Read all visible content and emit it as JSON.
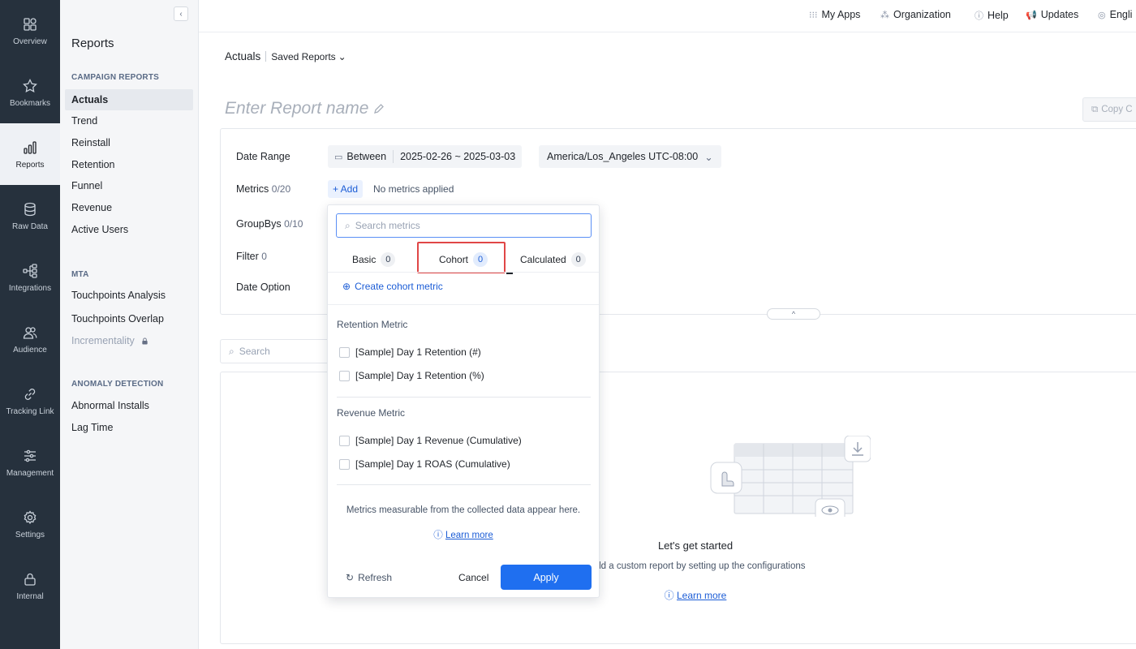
{
  "rail": {
    "items": [
      {
        "label": "Overview",
        "icon": "overview-icon"
      },
      {
        "label": "Bookmarks",
        "icon": "star-icon"
      },
      {
        "label": "Reports",
        "icon": "bar-chart-icon"
      },
      {
        "label": "Raw Data",
        "icon": "database-icon"
      },
      {
        "label": "Integrations",
        "icon": "integrations-icon"
      },
      {
        "label": "Audience",
        "icon": "audience-icon"
      },
      {
        "label": "Tracking Link",
        "icon": "link-icon"
      },
      {
        "label": "Management",
        "icon": "sliders-icon"
      },
      {
        "label": "Settings",
        "icon": "gear-icon"
      },
      {
        "label": "Internal",
        "icon": "lock-icon"
      }
    ],
    "active": "Reports"
  },
  "sidebar": {
    "title": "Reports",
    "sections": [
      {
        "title": "CAMPAIGN REPORTS",
        "items": [
          "Actuals",
          "Trend",
          "Reinstall",
          "Retention",
          "Funnel",
          "Revenue",
          "Active Users"
        ]
      },
      {
        "title": "MTA",
        "items": [
          "Touchpoints Analysis",
          "Touchpoints Overlap",
          "Incrementality"
        ]
      },
      {
        "title": "ANOMALY DETECTION",
        "items": [
          "Abnormal Installs",
          "Lag Time"
        ]
      }
    ],
    "active_item": "Actuals",
    "locked_item": "Incrementality"
  },
  "topbar": {
    "links": [
      "My Apps",
      "Organization",
      "Help",
      "Updates",
      "Engli"
    ]
  },
  "header": {
    "page": "Actuals",
    "saved_reports": "Saved Reports",
    "report_name_placeholder": "Enter Report name",
    "copy_button": "Copy C"
  },
  "config": {
    "date_range_label": "Date Range",
    "date_mode": "Between",
    "date_value": "2025-02-26 ~ 2025-03-03",
    "timezone": "America/Los_Angeles UTC-08:00",
    "metrics_label": "Metrics",
    "metrics_count": "0/20",
    "add_button": "+ Add",
    "no_metrics": "No metrics applied",
    "groupbys_label": "GroupBys",
    "groupbys_count": "0/10",
    "filter_label": "Filter",
    "filter_count": "0",
    "date_option_label": "Date Option"
  },
  "search": {
    "placeholder": "Search"
  },
  "empty_state": {
    "title": "Let's get started",
    "description": "Build a custom report by setting up the configurations",
    "link": "Learn more"
  },
  "metrics_popover": {
    "search_placeholder": "Search metrics",
    "tabs": [
      {
        "label": "Basic",
        "count": "0"
      },
      {
        "label": "Cohort",
        "count": "0"
      },
      {
        "label": "Calculated",
        "count": "0"
      }
    ],
    "active_tab": "Cohort",
    "create_link": "Create cohort metric",
    "groups": [
      {
        "title": "Retention Metric",
        "items": [
          "[Sample] Day 1 Retention (#)",
          "[Sample] Day 1 Retention (%)"
        ]
      },
      {
        "title": "Revenue Metric",
        "items": [
          "[Sample] Day 1 Revenue (Cumulative)",
          "[Sample] Day 1 ROAS (Cumulative)"
        ]
      }
    ],
    "note": "Metrics measurable from the collected data appear here.",
    "learn_more": "Learn more",
    "refresh": "Refresh",
    "cancel": "Cancel",
    "apply": "Apply"
  },
  "colors": {
    "rail_bg": "#26313d",
    "accent": "#1f6ff0",
    "link": "#1c5dd6",
    "highlight": "#e04646"
  }
}
